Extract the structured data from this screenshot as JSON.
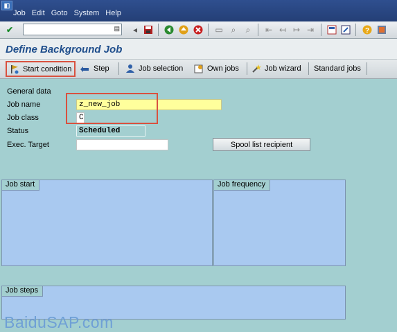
{
  "menu": {
    "system_icon": "sap-menu-icon",
    "items": [
      "Job",
      "Edit",
      "Goto",
      "System",
      "Help"
    ]
  },
  "toolbar": {
    "command_value": "",
    "buttons": [
      "enter-icon",
      "save-icon",
      "back-icon",
      "exit-icon",
      "cancel-icon",
      "print-icon",
      "find-icon",
      "find-next-icon",
      "first-page-icon",
      "prev-page-icon",
      "next-page-icon",
      "last-page-icon",
      "new-session-icon",
      "shortcut-icon",
      "help-icon",
      "layout-icon"
    ]
  },
  "title": "Define Background Job",
  "app_toolbar": {
    "start_condition": "Start condition",
    "step": "Step",
    "job_selection": "Job selection",
    "own_jobs": "Own jobs",
    "job_wizard": "Job wizard",
    "standard_jobs": "Standard jobs"
  },
  "form": {
    "section": "General data",
    "job_name_label": "Job name",
    "job_name_value": "z_new_job",
    "job_class_label": "Job class",
    "job_class_value": "C",
    "status_label": "Status",
    "status_value": "Scheduled",
    "exec_target_label": "Exec. Target",
    "exec_target_value": "",
    "spool_button": "Spool list recipient"
  },
  "groups": {
    "job_start": "Job start",
    "job_frequency": "Job frequency",
    "job_steps": "Job steps"
  },
  "watermark": "BaiduSAP.com",
  "colors": {
    "background": "#a3cfd0",
    "menubar": "#2f4f8f",
    "title": "#1f4e8c",
    "highlight": "#d9513f",
    "group_fill": "#a9c9f0",
    "required_field": "#ffff9c"
  }
}
